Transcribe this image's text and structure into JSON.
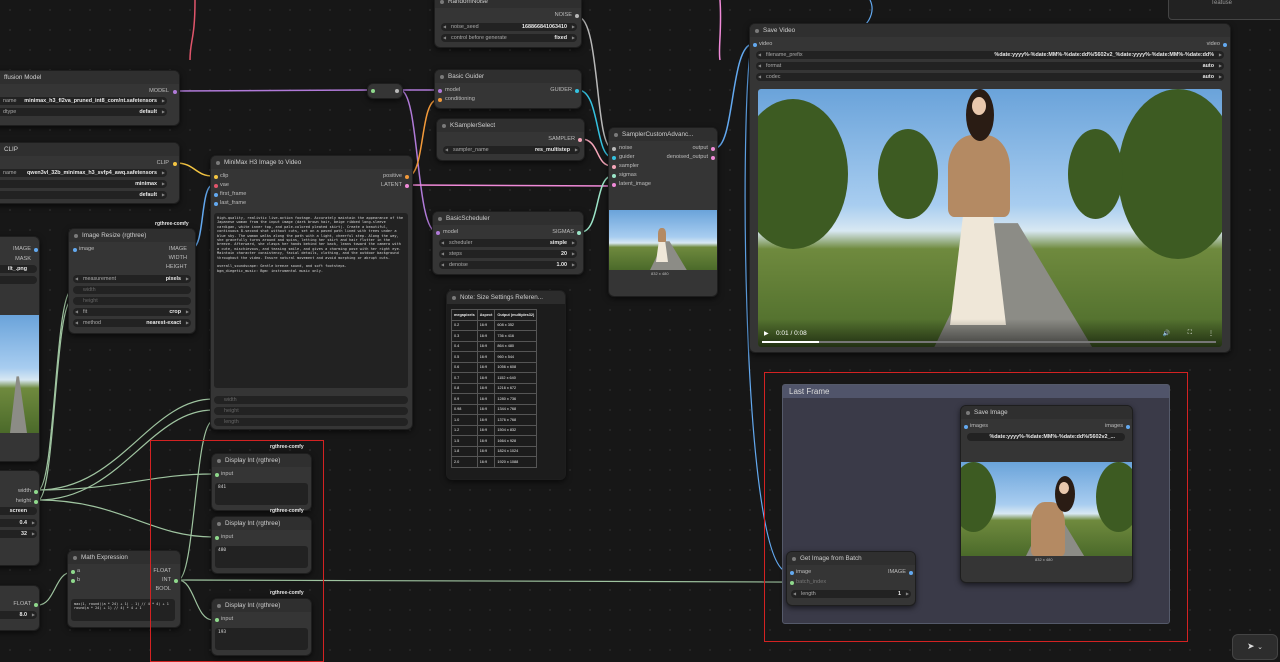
{
  "nodes": {
    "diffusion": {
      "title": "ffusion Model",
      "output": "MODEL",
      "unet_label": "name",
      "unet_value": "minimax_h3_fl2va_pruned_int8_com/nt.safetensors",
      "dtype_label": "dtype",
      "dtype_value": "default"
    },
    "clip": {
      "title": "CLIP",
      "output": "CLIP",
      "name_label": "name",
      "name_value": "qwen3vl_32b_minimax_h3_svfp4_awq.safetensors",
      "type_value": "minimax",
      "device_value": "default"
    },
    "random_noise": {
      "title": "RandomNoise",
      "output": "NOISE",
      "seed_label": "noise_seed",
      "seed_value": "168866841063410",
      "control_label": "control before generate",
      "control_value": "fixed"
    },
    "basic_guider": {
      "title": "Basic Guider",
      "in_model": "model",
      "in_cond": "conditioning",
      "output": "GUIDER"
    },
    "ksampler_select": {
      "title": "KSamplerSelect",
      "output": "SAMPLER",
      "sampler_label": "sampler_name",
      "sampler_value": "res_multistep"
    },
    "sampler_custom": {
      "title": "SamplerCustomAdvanc...",
      "in_noise": "noise",
      "in_guider": "guider",
      "in_sampler": "sampler",
      "in_sigmas": "sigmas",
      "in_latent": "latent_image",
      "out_output": "output",
      "out_denoised": "denoised_output",
      "caption": "832 x 480"
    },
    "i2v": {
      "title": "MiniMax H3 Image to Video",
      "in_clip": "clip",
      "in_vae": "vae",
      "in_first": "first_frame",
      "in_last": "last_frame",
      "out_positive": "positive",
      "out_latent": "LATENT",
      "badge": "rgthree-comfy",
      "prompt": "High-quality, realistic live-action footage. Accurately maintain the appearance of the Japanese woman from the input image (dark brown hair, beige ribbed long-sleeve cardigan, white inner top, and pale-colored pleated skirt). Create a beautiful, continuous 8-second shot without cuts, set on a paved path lined with trees under a blue sky. The woman walks along the path with a light, cheerful step. Along the way, she gracefully turns around and spins, letting her skirt and hair flutter in the breeze. Afterward, she clasps her hands behind her back, leans toward the camera with a cute, mischievous, and teasing smile, and gives a charming pose with her right eye. Maintain character consistency, facial details, clothing, and the outdoor background throughout the video. Ensure natural movement and avoid morphing or abrupt cuts.\n\noverall_soundscape: Gentle breeze sound, and soft footsteps.\nbgm_diegetic_music: Bgm: instrumental music only.",
      "w_width": "width",
      "w_height": "height",
      "w_length": "length"
    },
    "basic_scheduler": {
      "title": "BasicScheduler",
      "in_model": "model",
      "output": "SIGMAS",
      "scheduler_label": "scheduler",
      "scheduler_value": "simple",
      "steps_label": "steps",
      "steps_value": "20",
      "denoise_label": "denoise",
      "denoise_value": "1.00"
    },
    "image_resize": {
      "title": "Image Resize (rgthree)",
      "badge": "rgthree-comfy",
      "in_image": "image",
      "out_image": "IMAGE",
      "out_width": "WIDTH",
      "out_height": "HEIGHT",
      "measurement_label": "measurement",
      "measurement_value": "pixels",
      "width_label": "width",
      "height_label": "height",
      "fit_label": "fit",
      "fit_value": "crop",
      "method_label": "method",
      "method_value": "nearest-exact"
    },
    "load_image": {
      "out_image": "IMAGE",
      "out_mask": "MASK",
      "file_value": "ilt_.png"
    },
    "size_note": {
      "title": "Note: Size Settings Referen...",
      "headers": [
        "megapixels",
        "Aspect",
        "Output (multiples32)"
      ],
      "rows": [
        [
          "0.2",
          "16:9",
          "608 x 352"
        ],
        [
          "0.3",
          "16:9",
          "736 x 416"
        ],
        [
          "0.4",
          "16:9",
          "864 x 480"
        ],
        [
          "0.5",
          "16:9",
          "960 x 544"
        ],
        [
          "0.6",
          "16:9",
          "1056 x 608"
        ],
        [
          "0.7",
          "16:9",
          "1152 x 640"
        ],
        [
          "0.8",
          "16:9",
          "1216 x 672"
        ],
        [
          "0.9",
          "16:9",
          "1280 x 736"
        ],
        [
          "0.98",
          "16:9",
          "1344 x 768"
        ],
        [
          "1.0",
          "16:9",
          "1376 x 768"
        ],
        [
          "1.2",
          "16:9",
          "1504 x 832"
        ],
        [
          "1.5",
          "16:9",
          "1664 x 928"
        ],
        [
          "1.8",
          "16:9",
          "1824 x 1024"
        ],
        [
          "2.0",
          "16:9",
          "1920 x 1088"
        ]
      ]
    },
    "display1": {
      "title": "Display Int (rgthree)",
      "badge": "rgthree-comfy",
      "input": "input",
      "value": "841"
    },
    "display2": {
      "title": "Display Int (rgthree)",
      "badge": "rgthree-comfy",
      "input": "input",
      "value": "480"
    },
    "display3": {
      "title": "Display Int (rgthree)",
      "badge": "rgthree-comfy",
      "input": "input",
      "value": "193"
    },
    "math": {
      "title": "Math Expression",
      "in_a": "a",
      "in_b": "b",
      "out_float": "FLOAT",
      "out_int": "INT",
      "out_bool": "BOOL",
      "expr": "max(1, round((a * 24) + 1) - 1) // 4 * 4) + 1\nround(a * 24) + 1) // 4) * 4 + 1"
    },
    "left_panel": {
      "out_width": "width",
      "out_height": "height",
      "screen_value": "screen",
      "val1": "0.4",
      "val2": "32"
    },
    "float_node": {
      "output": "FLOAT",
      "value": "8.0"
    },
    "save_video": {
      "title": "Save Video",
      "in_video": "video",
      "out_video": "video",
      "filename_label": "filename_prefix",
      "filename_value": "%date:yyyy%-%date:MM%-%date:dd%/5602v2_%date:yyyy%-%date:MM%-%date:dd%",
      "format_label": "format",
      "format_value": "auto",
      "codec_label": "codec",
      "codec_value": "auto",
      "time": "0:01 / 0:08",
      "progress": 0.125
    },
    "last_frame_group": {
      "title": "Last Frame"
    },
    "save_image": {
      "title": "Save Image",
      "in_images": "images",
      "out_images": "images",
      "prefix_value": "%date:yyyy%-%date:MM%-%date:dd%/5602v2_...",
      "caption": "832 x 480"
    },
    "get_image": {
      "title": "Get Image from Batch",
      "in_image": "image",
      "in_batch": "batch_index",
      "out_image": "IMAGE",
      "length_label": "length",
      "length_value": "1"
    },
    "top_right": {
      "label": "Teatuse"
    }
  },
  "colors": {
    "clip": "#f4c542",
    "model": "#b07ad8",
    "conditioning": "#f39a3a",
    "latent": "#f08ad8",
    "image": "#63a9f0",
    "int": "#8fd98c",
    "noise": "#b8b8b8",
    "sampler": "#f5a6b9",
    "sigmas": "#9ce5c8",
    "guider": "#35c2e0",
    "highlight": "#d32222"
  }
}
